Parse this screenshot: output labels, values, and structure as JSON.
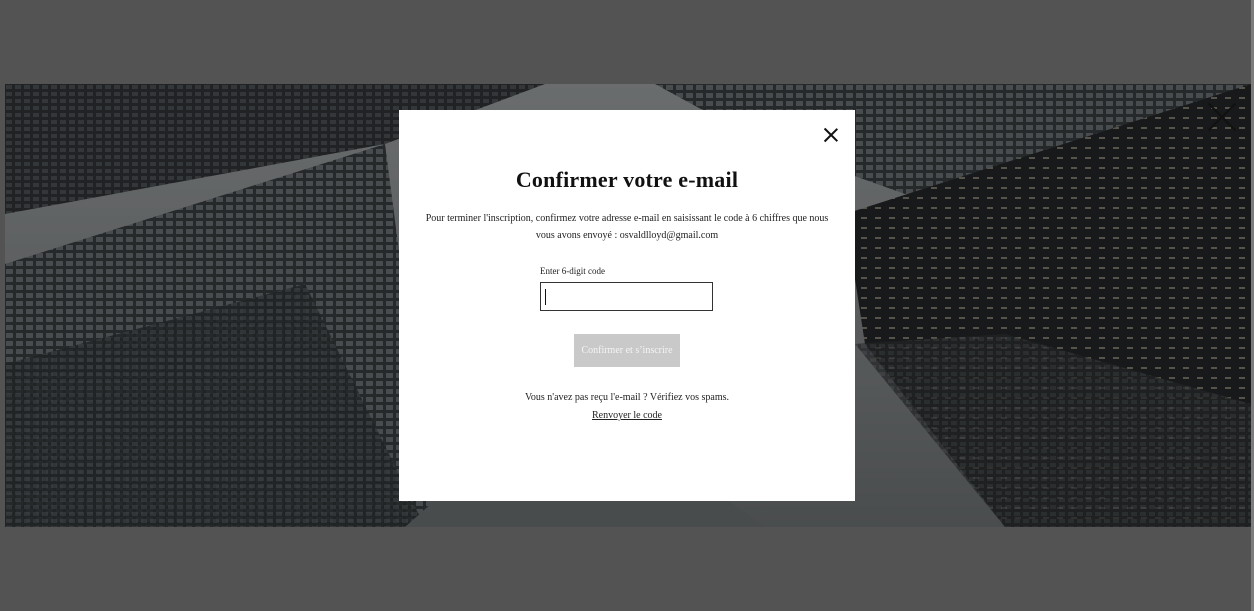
{
  "modal": {
    "title": "Confirmer votre e-mail",
    "description": "Pour terminer l'inscription, confirmez votre adresse e-mail en saisissant le code à 6 chiffres que nous vous avons envoyé : osvaldlloyd@gmail.com",
    "code_label": "Enter 6-digit code",
    "code_value": "",
    "submit_label": "Confirmer et s’inscrire",
    "no_mail_text": "Vous n'avez pas reçu l'e-mail ? Vérifiez vos spams.",
    "resend_label": "Renvoyer le code",
    "close_icon": "close-icon"
  },
  "page": {
    "close_icon": "close-icon",
    "background": "skyscrapers-photo"
  },
  "colors": {
    "overlay": "#6b6b6b",
    "modal_bg": "#ffffff",
    "button_disabled": "#c9c9c9",
    "text": "#222222"
  }
}
